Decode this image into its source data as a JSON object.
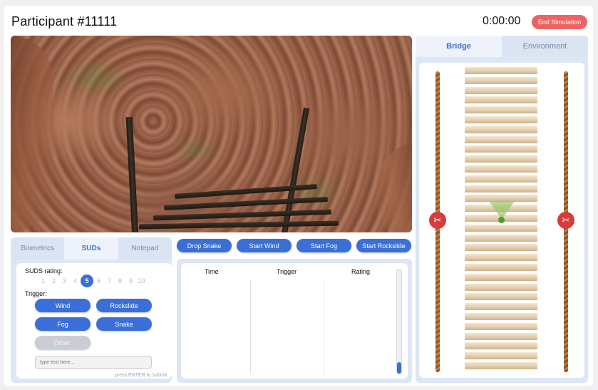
{
  "header": {
    "participant": "Participant #11111",
    "timer": "0:00:00",
    "end_label": "End Simulation"
  },
  "left_tabs": [
    {
      "label": "Biometrics",
      "active": false
    },
    {
      "label": "SUDs",
      "active": true
    },
    {
      "label": "Notepad",
      "active": false
    }
  ],
  "actions": [
    "Drop Snake",
    "Start Wind",
    "Start Fog",
    "Start Rockslide"
  ],
  "suds": {
    "rating_label": "SUDS rating:",
    "scale": [
      "1",
      "2",
      "3",
      "4",
      "5",
      "6",
      "7",
      "8",
      "9",
      "10"
    ],
    "selected": "5",
    "trigger_label": "Trigger:",
    "triggers": [
      "Wind",
      "Rockslide",
      "Fog",
      "Snake"
    ],
    "other_label": "Other:",
    "input_placeholder": "type text here...",
    "hint": "press ENTER to submit"
  },
  "log": {
    "columns": [
      "Time",
      "Trigger",
      "Rating"
    ],
    "rows": []
  },
  "right_tabs": [
    {
      "label": "Bridge",
      "active": true
    },
    {
      "label": "Environment",
      "active": false
    }
  ],
  "colors": {
    "accent": "#3b6fd8",
    "danger": "#f06262",
    "panel": "#dde6f4"
  },
  "icons": {
    "cut_rope": "scissors-icon"
  }
}
